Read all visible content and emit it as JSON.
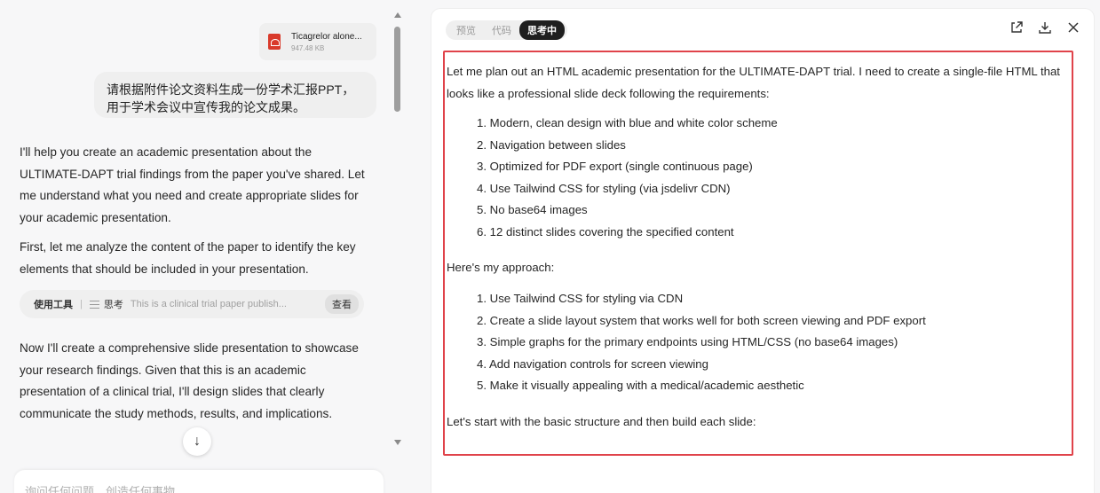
{
  "chat": {
    "attachment": {
      "name": "Ticagrelor alone...",
      "size": "947.48 KB"
    },
    "user_message": "请根据附件论文资料生成一份学术汇报PPT，用于学术会议中宣传我的论文成果。",
    "assistant": {
      "para1": "I'll help you create an academic presentation about the ULTIMATE-DAPT trial findings from the paper you've shared. Let me understand what you need and create appropriate slides for your academic presentation.",
      "para2": "First, let me analyze the content of the paper to identify the key elements that should be included in your presentation.",
      "tool": {
        "label": "使用工具",
        "separator": "|",
        "name": "思考",
        "description": "This is a clinical trial paper publish...",
        "button": "查看"
      },
      "para3": "Now I'll create a comprehensive slide presentation to showcase your research findings. Given that this is an academic presentation of a clinical trial, I'll design slides that clearly communicate the study methods, results, and implications."
    },
    "scroll_down_glyph": "↓",
    "input_placeholder": "询问任何问题，创造任何事物"
  },
  "panel": {
    "tabs": [
      {
        "label": "预览",
        "active": false
      },
      {
        "label": "代码",
        "active": false
      },
      {
        "label": "思考中",
        "active": true
      }
    ],
    "icons": [
      "open-external-icon",
      "download-icon",
      "close-icon"
    ],
    "accent_color": "#e0434a",
    "thinking": {
      "intro": "Let me plan out an HTML academic presentation for the ULTIMATE-DAPT trial. I need to create a single-file HTML that looks like a professional slide deck following the requirements:",
      "requirements": [
        "Modern, clean design with blue and white color scheme",
        "Navigation between slides",
        "Optimized for PDF export (single continuous page)",
        "Use Tailwind CSS for styling (via jsdelivr CDN)",
        "No base64 images",
        "12 distinct slides covering the specified content"
      ],
      "approach_heading": "Here's my approach:",
      "approach": [
        "Use Tailwind CSS for styling via CDN",
        "Create a slide layout system that works well for both screen viewing and PDF export",
        "Simple graphs for the primary endpoints using HTML/CSS (no base64 images)",
        "Add navigation controls for screen viewing",
        "Make it visually appealing with a medical/academic aesthetic"
      ],
      "closing": "Let's start with the basic structure and then build each slide:"
    }
  }
}
